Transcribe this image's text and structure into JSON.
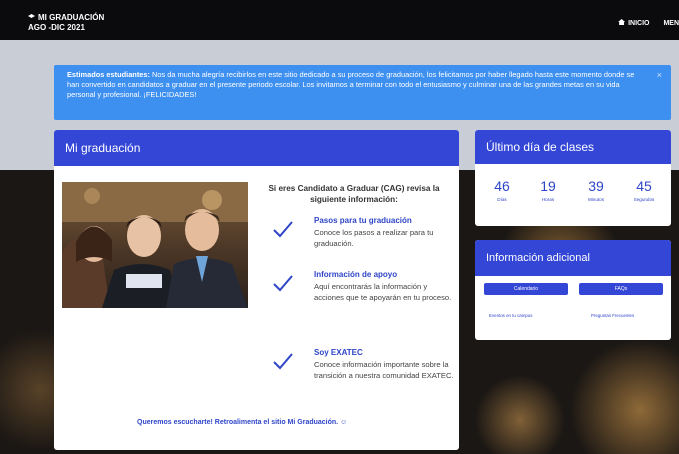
{
  "header": {
    "title": "MI GRADUACIÓN",
    "period": "AGO -DIC 2021",
    "nav": {
      "home_label": "INICIO",
      "menu_label": "MEN"
    }
  },
  "alert": {
    "lead": "Estimados estudiantes:",
    "message": " Nos da mucha alegría recibirlos en este sitio dedicado a su proceso de graduación, los felicitamos por haber llegado hasta este momento donde se han convertido en candidatos a graduar en el presente periodo escolar. Los invitamos a terminar con todo el entusiasmo y culminar una de las grandes metas en su vida personal y profesional. ¡FELICIDADES!"
  },
  "main": {
    "title": "Mi graduación",
    "intro": "Si eres Candidato a Graduar (CAG) revisa la siguiente información:",
    "items": [
      {
        "title": "Pasos para tu graduación",
        "desc": "Conoce los pasos a realizar para tu graduación."
      },
      {
        "title": "Información de apoyo",
        "desc": "Aquí encontrarás la información y acciones que te apoyarán en tu proceso."
      },
      {
        "title": "Soy EXATEC",
        "desc": "Conoce información importante sobre la transición a nuestra comunidad EXATEC."
      }
    ],
    "feedback": "Queremos escucharte! Retroalimenta el sitio Mi Graduación. ☺"
  },
  "last_day": {
    "title": "Último día de clases",
    "units": [
      {
        "value": "46",
        "label": "Días"
      },
      {
        "value": "19",
        "label": "Horas"
      },
      {
        "value": "39",
        "label": "Minutos"
      },
      {
        "value": "45",
        "label": "Segundos"
      }
    ]
  },
  "info": {
    "title": "Información adicional",
    "buttons": [
      "Calendario",
      "FAQs"
    ],
    "links": [
      "Eventos en tu campus",
      "Preguntas Frecuentes"
    ]
  },
  "colors": {
    "accent": "#3346d6",
    "alert": "#3d8ff0",
    "topbar": "#0b0b0d"
  }
}
